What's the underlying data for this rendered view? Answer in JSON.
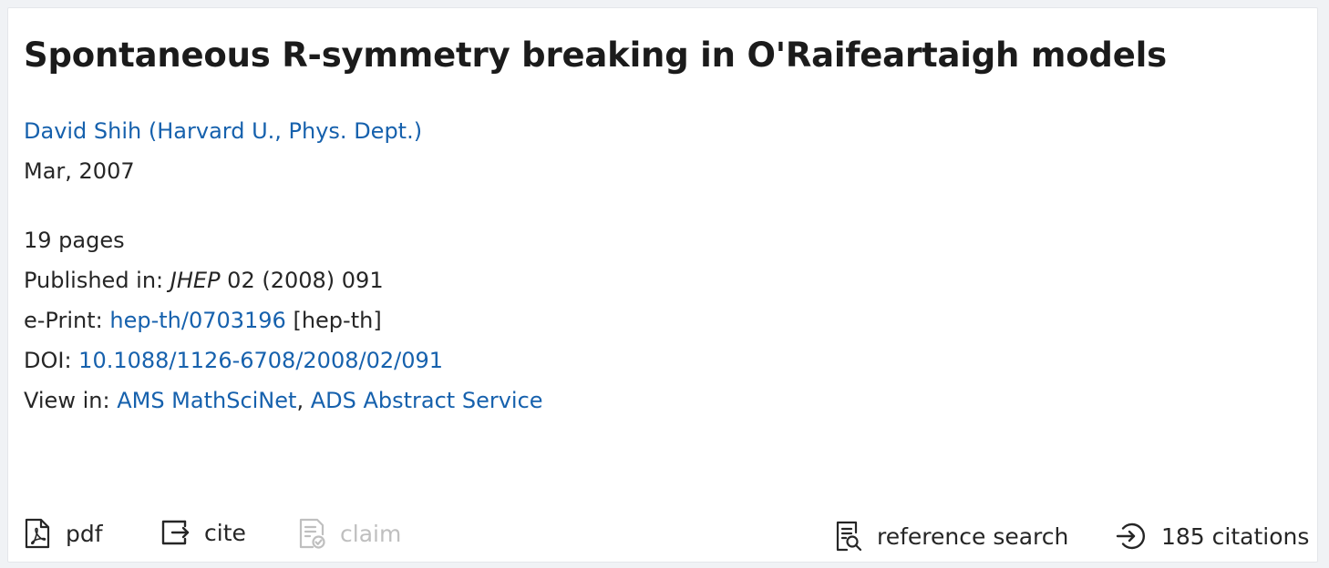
{
  "title": "Spontaneous R-symmetry breaking in O'Raifeartaigh models",
  "authors": {
    "name": "David Shih",
    "affiliation_open": " (",
    "affiliation": "Harvard U., Phys. Dept.",
    "affiliation_close": ")"
  },
  "date": "Mar, 2007",
  "pages": "19 pages",
  "published": {
    "label": "Published in: ",
    "journal": "JHEP",
    "rest": " 02 (2008) 091"
  },
  "eprint": {
    "label": "e-Print: ",
    "id": "hep-th/0703196",
    "category": " [hep-th]"
  },
  "doi": {
    "label": "DOI: ",
    "value": "10.1088/1126-6708/2008/02/091"
  },
  "view_in": {
    "label": "View in: ",
    "links": [
      "AMS MathSciNet",
      "ADS Abstract Service"
    ],
    "separator": ", "
  },
  "actions": {
    "pdf": "pdf",
    "cite": "cite",
    "claim": "claim",
    "reference_search": "reference search",
    "citations": "185 citations"
  },
  "colors": {
    "link": "#1661ad",
    "text": "#262626",
    "disabled": "#bfbfbf"
  },
  "icons": {
    "pdf": "file-pdf-icon",
    "cite": "export-icon",
    "claim": "file-check-icon",
    "reference_search": "file-search-icon",
    "citations": "login-icon"
  }
}
